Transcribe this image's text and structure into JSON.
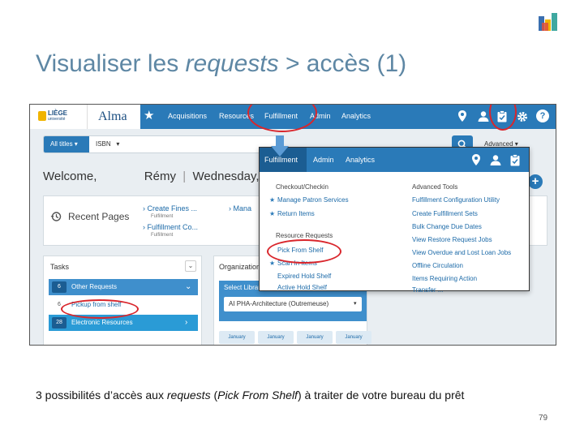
{
  "slide": {
    "title_prefix": "Visualiser les ",
    "title_italic": "requests",
    "title_suffix": " > accès (1)",
    "caption_prefix": "3 possibilités d’accès aux ",
    "caption_italic1": "requests",
    "caption_mid": " (",
    "caption_italic2": "Pick From Shelf",
    "caption_suffix": ") à traiter de votre bureau du prêt",
    "page_number": "79"
  },
  "alma": {
    "brand": {
      "institution": "LIÈGE",
      "institution_sub": "université",
      "product": "Alma"
    },
    "nav": {
      "links": [
        "Acquisitions",
        "Resources",
        "Fulfillment",
        "Admin",
        "Analytics"
      ],
      "icons": [
        "location-pin-icon",
        "person-icon",
        "clipboard-check-icon",
        "gear-icon",
        "help-icon"
      ],
      "help_label": "?"
    },
    "search": {
      "scope": "All titles ▾",
      "field": "ISBN",
      "field_caret": "▾",
      "advanced": "Advanced ▾"
    },
    "welcome": {
      "greeting": "Welcome,",
      "name": "Rémy",
      "separator": "|",
      "date": "Wednesday, Ja"
    },
    "recent": {
      "title": "Recent Pages",
      "items": [
        {
          "label": "Create Fines ...",
          "sub": "Fulfillment"
        },
        {
          "label": "Fulfillment Co...",
          "sub": "Fulfillment"
        },
        {
          "label": "Mana"
        }
      ]
    },
    "tasks": {
      "title": "Tasks",
      "toggle": "⌄",
      "rows": [
        {
          "count": "6",
          "label": "Other Requests",
          "chevron": "⌄"
        },
        {
          "count": "6",
          "label": "Pickup from shelf",
          "chevron": ""
        },
        {
          "count": "28",
          "label": "Electronic Resources",
          "chevron": "›"
        }
      ]
    },
    "organization": {
      "title": "Organization",
      "select_label": "Select Librar",
      "selected": "AI PHA-Architecture (Outremeuse)",
      "caret": "▾",
      "months": [
        "January",
        "January",
        "January",
        "January"
      ]
    },
    "fulfillment_menu": {
      "tabs": [
        "Fulfillment",
        "Admin",
        "Analytics"
      ],
      "icons": [
        "location-pin-icon",
        "person-icon",
        "clipboard-check-icon"
      ],
      "left_sections": [
        {
          "heading": "Checkout/Checkin",
          "items": [
            {
              "label": "Manage Patron Services",
              "starred": true
            },
            {
              "label": "Return Items",
              "starred": true
            }
          ]
        },
        {
          "heading": "Resource Requests",
          "items": [
            {
              "label": "Pick From Shelf",
              "starred": false
            },
            {
              "label": "Scan In Items",
              "starred": true
            },
            {
              "label": "Expired Hold Shelf",
              "starred": false
            },
            {
              "label": "Active Hold Shelf",
              "starred": false
            }
          ]
        }
      ],
      "right_section": {
        "heading": "Advanced Tools",
        "items": [
          "Fulfillment Configuration Utility",
          "Create Fulfillment Sets",
          "Bulk Change Due Dates",
          "View Restore Request Jobs",
          "View Overdue and Lost Loan Jobs",
          "Offline Circulation",
          "Items Requiring Action",
          "Transfer ..."
        ]
      },
      "star_glyph": "★"
    },
    "annotation_color": "#d9262c",
    "accent_color": "#2a7ab8"
  }
}
